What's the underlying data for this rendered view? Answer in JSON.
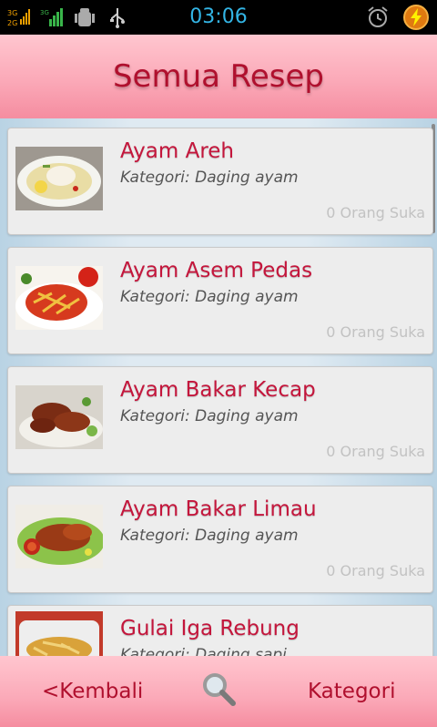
{
  "status_bar": {
    "time": "03:06",
    "icons": [
      "3g-signal-icon",
      "signal-bars-icon",
      "android-debug-icon",
      "usb-icon",
      "alarm-icon",
      "battery-charging-icon"
    ]
  },
  "header": {
    "title": "Semua Resep"
  },
  "recipes": [
    {
      "title": "Ayam Areh",
      "category": "Kategori: Daging ayam",
      "likes": "0 Orang Suka"
    },
    {
      "title": "Ayam Asem Pedas",
      "category": "Kategori: Daging ayam",
      "likes": "0 Orang Suka"
    },
    {
      "title": "Ayam Bakar Kecap",
      "category": "Kategori: Daging ayam",
      "likes": "0 Orang Suka"
    },
    {
      "title": "Ayam Bakar Limau",
      "category": "Kategori: Daging ayam",
      "likes": "0 Orang Suka"
    },
    {
      "title": "Gulai Iga Rebung",
      "category": "Kategori: Daging sapi",
      "likes": ""
    }
  ],
  "bottom_bar": {
    "back_label": "<Kembali",
    "category_label": "Kategori",
    "search_icon": "search-icon"
  }
}
